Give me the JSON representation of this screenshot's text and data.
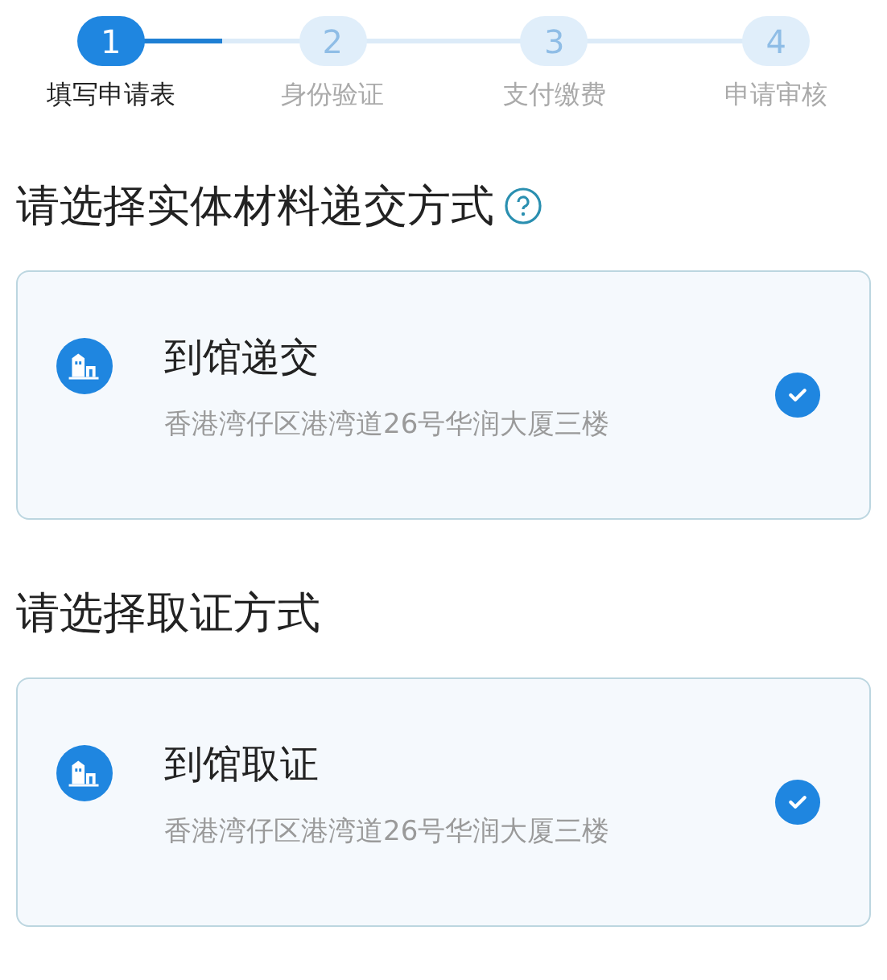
{
  "steps": [
    {
      "number": "1",
      "label": "填写申请表",
      "active": true
    },
    {
      "number": "2",
      "label": "身份验证",
      "active": false
    },
    {
      "number": "3",
      "label": "支付缴费",
      "active": false
    },
    {
      "number": "4",
      "label": "申请审核",
      "active": false
    }
  ],
  "sections": [
    {
      "title": "请选择实体材料递交方式",
      "help_icon": true,
      "options": [
        {
          "title": "到馆递交",
          "address": "香港湾仔区港湾道26号华润大厦三楼",
          "selected": true
        }
      ]
    },
    {
      "title": "请选择取证方式",
      "help_icon": false,
      "options": [
        {
          "title": "到馆取证",
          "address": "香港湾仔区港湾道26号华润大厦三楼",
          "selected": true
        }
      ]
    }
  ]
}
